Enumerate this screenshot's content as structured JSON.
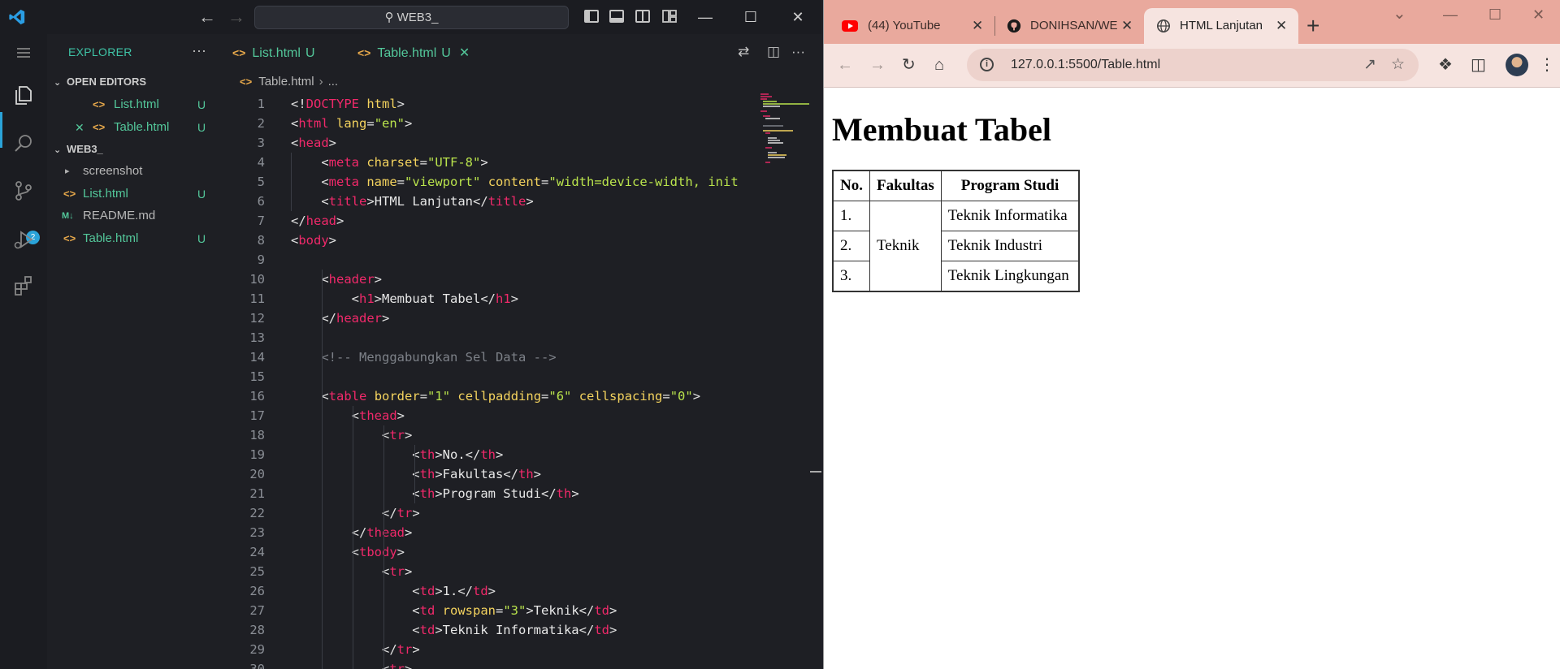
{
  "vscode": {
    "search_label": "WEB3_",
    "explorer_title": "EXPLORER",
    "open_editors_label": "OPEN EDITORS",
    "open_editors": [
      {
        "name": "List.html",
        "status": "U"
      },
      {
        "name": "Table.html",
        "status": "U"
      }
    ],
    "folder_label": "WEB3_",
    "files": [
      {
        "name": "screenshot",
        "status": ""
      },
      {
        "name": "List.html",
        "status": "U"
      },
      {
        "name": "README.md",
        "status": ""
      },
      {
        "name": "Table.html",
        "status": "U"
      }
    ],
    "tabs": [
      {
        "label": "List.html",
        "status": "U"
      },
      {
        "label": "Table.html",
        "status": "U"
      }
    ],
    "breadcrumb": {
      "file": "Table.html",
      "rest": "..."
    },
    "scm_badge": "2",
    "code_lines": [
      [
        [
          "p",
          "<!"
        ],
        [
          "g",
          "DOCTYPE"
        ],
        [
          "p",
          " "
        ],
        [
          "a",
          "html"
        ],
        [
          "p",
          ">"
        ]
      ],
      [
        [
          "p",
          "<"
        ],
        [
          "g",
          "html"
        ],
        [
          "p",
          " "
        ],
        [
          "a",
          "lang"
        ],
        [
          "p",
          "="
        ],
        [
          "s",
          "\"en\""
        ],
        [
          "p",
          ">"
        ]
      ],
      [
        [
          "p",
          "<"
        ],
        [
          "g",
          "head"
        ],
        [
          "p",
          ">"
        ]
      ],
      [
        [
          "p",
          "    <"
        ],
        [
          "g",
          "meta"
        ],
        [
          "p",
          " "
        ],
        [
          "a",
          "charset"
        ],
        [
          "p",
          "="
        ],
        [
          "s",
          "\"UTF-8\""
        ],
        [
          "p",
          ">"
        ]
      ],
      [
        [
          "p",
          "    <"
        ],
        [
          "g",
          "meta"
        ],
        [
          "p",
          " "
        ],
        [
          "a",
          "name"
        ],
        [
          "p",
          "="
        ],
        [
          "s",
          "\"viewport\""
        ],
        [
          "p",
          " "
        ],
        [
          "a",
          "content"
        ],
        [
          "p",
          "="
        ],
        [
          "s",
          "\"width=device-width, init"
        ]
      ],
      [
        [
          "p",
          "    <"
        ],
        [
          "g",
          "title"
        ],
        [
          "p",
          ">"
        ],
        [
          "t",
          "HTML Lanjutan"
        ],
        [
          "p",
          "</"
        ],
        [
          "g",
          "title"
        ],
        [
          "p",
          ">"
        ]
      ],
      [
        [
          "p",
          "</"
        ],
        [
          "g",
          "head"
        ],
        [
          "p",
          ">"
        ]
      ],
      [
        [
          "p",
          "<"
        ],
        [
          "g",
          "body"
        ],
        [
          "p",
          ">"
        ]
      ],
      [],
      [
        [
          "p",
          "    <"
        ],
        [
          "g",
          "header"
        ],
        [
          "p",
          ">"
        ]
      ],
      [
        [
          "p",
          "        <"
        ],
        [
          "g",
          "h1"
        ],
        [
          "p",
          ">"
        ],
        [
          "t",
          "Membuat Tabel"
        ],
        [
          "p",
          "</"
        ],
        [
          "g",
          "h1"
        ],
        [
          "p",
          ">"
        ]
      ],
      [
        [
          "p",
          "    </"
        ],
        [
          "g",
          "header"
        ],
        [
          "p",
          ">"
        ]
      ],
      [],
      [
        [
          "c",
          "    <!-- Menggabungkan Sel Data -->"
        ]
      ],
      [],
      [
        [
          "p",
          "    <"
        ],
        [
          "g",
          "table"
        ],
        [
          "p",
          " "
        ],
        [
          "a",
          "border"
        ],
        [
          "p",
          "="
        ],
        [
          "s",
          "\"1\""
        ],
        [
          "p",
          " "
        ],
        [
          "a",
          "cellpadding"
        ],
        [
          "p",
          "="
        ],
        [
          "s",
          "\"6\""
        ],
        [
          "p",
          " "
        ],
        [
          "a",
          "cellspacing"
        ],
        [
          "p",
          "="
        ],
        [
          "s",
          "\"0\""
        ],
        [
          "p",
          ">"
        ]
      ],
      [
        [
          "p",
          "        <"
        ],
        [
          "g",
          "thead"
        ],
        [
          "p",
          ">"
        ]
      ],
      [
        [
          "p",
          "            <"
        ],
        [
          "g",
          "tr"
        ],
        [
          "p",
          ">"
        ]
      ],
      [
        [
          "p",
          "                <"
        ],
        [
          "g",
          "th"
        ],
        [
          "p",
          ">"
        ],
        [
          "t",
          "No."
        ],
        [
          "p",
          "</"
        ],
        [
          "g",
          "th"
        ],
        [
          "p",
          ">"
        ]
      ],
      [
        [
          "p",
          "                <"
        ],
        [
          "g",
          "th"
        ],
        [
          "p",
          ">"
        ],
        [
          "t",
          "Fakultas"
        ],
        [
          "p",
          "</"
        ],
        [
          "g",
          "th"
        ],
        [
          "p",
          ">"
        ]
      ],
      [
        [
          "p",
          "                <"
        ],
        [
          "g",
          "th"
        ],
        [
          "p",
          ">"
        ],
        [
          "t",
          "Program Studi"
        ],
        [
          "p",
          "</"
        ],
        [
          "g",
          "th"
        ],
        [
          "p",
          ">"
        ]
      ],
      [
        [
          "p",
          "            </"
        ],
        [
          "g",
          "tr"
        ],
        [
          "p",
          ">"
        ]
      ],
      [
        [
          "p",
          "        </"
        ],
        [
          "g",
          "thead"
        ],
        [
          "p",
          ">"
        ]
      ],
      [
        [
          "p",
          "        <"
        ],
        [
          "g",
          "tbody"
        ],
        [
          "p",
          ">"
        ]
      ],
      [
        [
          "p",
          "            <"
        ],
        [
          "g",
          "tr"
        ],
        [
          "p",
          ">"
        ]
      ],
      [
        [
          "p",
          "                <"
        ],
        [
          "g",
          "td"
        ],
        [
          "p",
          ">"
        ],
        [
          "t",
          "1."
        ],
        [
          "p",
          "</"
        ],
        [
          "g",
          "td"
        ],
        [
          "p",
          ">"
        ]
      ],
      [
        [
          "p",
          "                <"
        ],
        [
          "g",
          "td"
        ],
        [
          "p",
          " "
        ],
        [
          "a",
          "rowspan"
        ],
        [
          "p",
          "="
        ],
        [
          "s",
          "\"3\""
        ],
        [
          "p",
          ">"
        ],
        [
          "t",
          "Teknik"
        ],
        [
          "p",
          "</"
        ],
        [
          "g",
          "td"
        ],
        [
          "p",
          ">"
        ]
      ],
      [
        [
          "p",
          "                <"
        ],
        [
          "g",
          "td"
        ],
        [
          "p",
          ">"
        ],
        [
          "t",
          "Teknik Informatika"
        ],
        [
          "p",
          "</"
        ],
        [
          "g",
          "td"
        ],
        [
          "p",
          ">"
        ]
      ],
      [
        [
          "p",
          "            </"
        ],
        [
          "g",
          "tr"
        ],
        [
          "p",
          ">"
        ]
      ],
      [
        [
          "p",
          "            <"
        ],
        [
          "g",
          "tr"
        ],
        [
          "p",
          ">"
        ]
      ]
    ]
  },
  "browser": {
    "tabs": [
      {
        "title": "(44) YouTube"
      },
      {
        "title": "DONIHSAN/WE"
      },
      {
        "title": "HTML Lanjutan"
      }
    ],
    "url": "127.0.0.1:5500/Table.html",
    "page": {
      "heading": "Membuat Tabel",
      "table": {
        "headers": [
          "No.",
          "Fakultas",
          "Program Studi"
        ],
        "rows": [
          {
            "no": "1.",
            "prodi": "Teknik Informatika"
          },
          {
            "no": "2.",
            "prodi": "Teknik Industri"
          },
          {
            "no": "3.",
            "prodi": "Teknik Lingkungan"
          }
        ],
        "fakultas": "Teknik"
      }
    }
  },
  "colors": {
    "tag": "#f0296a",
    "attr": "#f4d35e",
    "string": "#b9e34c",
    "untracked": "#53c79a",
    "browser_frame": "#e9a99d"
  }
}
